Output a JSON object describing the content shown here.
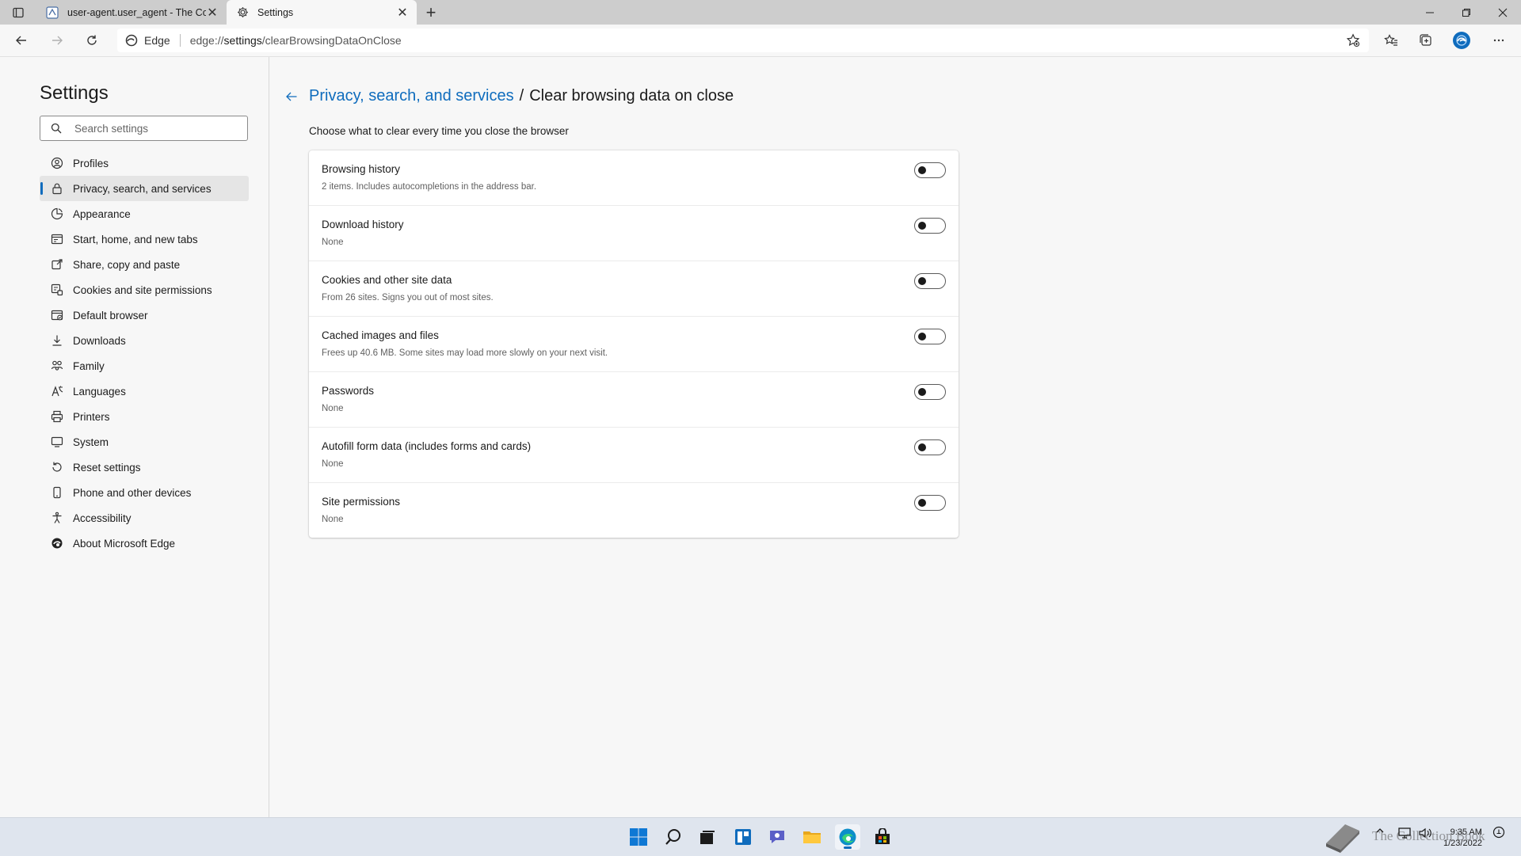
{
  "browser": {
    "tabs": [
      {
        "title": "user-agent.user_agent - The Coll",
        "active": false
      },
      {
        "title": "Settings",
        "active": true
      }
    ],
    "address": {
      "site_label": "Edge",
      "url_prefix": "edge://",
      "url_bold": "settings",
      "url_rest": "/clearBrowsingDataOnClose"
    },
    "accent": "#0f6cbd"
  },
  "sidebar": {
    "title": "Settings",
    "search_placeholder": "Search settings",
    "items": [
      {
        "label": "Profiles",
        "icon": "profile-icon"
      },
      {
        "label": "Privacy, search, and services",
        "icon": "lock-icon",
        "selected": true
      },
      {
        "label": "Appearance",
        "icon": "appearance-icon"
      },
      {
        "label": "Start, home, and new tabs",
        "icon": "home-tabs-icon"
      },
      {
        "label": "Share, copy and paste",
        "icon": "share-icon"
      },
      {
        "label": "Cookies and site permissions",
        "icon": "cookies-icon"
      },
      {
        "label": "Default browser",
        "icon": "default-browser-icon"
      },
      {
        "label": "Downloads",
        "icon": "download-icon"
      },
      {
        "label": "Family",
        "icon": "family-icon"
      },
      {
        "label": "Languages",
        "icon": "languages-icon"
      },
      {
        "label": "Printers",
        "icon": "printer-icon"
      },
      {
        "label": "System",
        "icon": "system-icon"
      },
      {
        "label": "Reset settings",
        "icon": "reset-icon"
      },
      {
        "label": "Phone and other devices",
        "icon": "phone-icon"
      },
      {
        "label": "Accessibility",
        "icon": "accessibility-icon"
      },
      {
        "label": "About Microsoft Edge",
        "icon": "edge-icon"
      }
    ]
  },
  "main": {
    "breadcrumb_parent": "Privacy, search, and services",
    "breadcrumb_separator": "/",
    "page_title": "Clear browsing data on close",
    "description": "Choose what to clear every time you close the browser",
    "options": [
      {
        "title": "Browsing history",
        "subtitle": "2 items. Includes autocompletions in the address bar.",
        "enabled": false
      },
      {
        "title": "Download history",
        "subtitle": "None",
        "enabled": false
      },
      {
        "title": "Cookies and other site data",
        "subtitle": "From 26 sites. Signs you out of most sites.",
        "enabled": false
      },
      {
        "title": "Cached images and files",
        "subtitle": "Frees up 40.6 MB. Some sites may load more slowly on your next visit.",
        "enabled": false
      },
      {
        "title": "Passwords",
        "subtitle": "None",
        "enabled": false
      },
      {
        "title": "Autofill form data (includes forms and cards)",
        "subtitle": "None",
        "enabled": false
      },
      {
        "title": "Site permissions",
        "subtitle": "None",
        "enabled": false
      }
    ]
  },
  "taskbar": {
    "time": "9:35 AM",
    "date": "1/23/2022",
    "watermark": "The Collection Book"
  }
}
